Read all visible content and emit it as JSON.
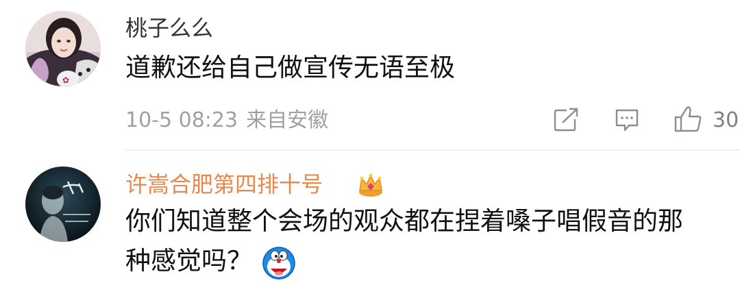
{
  "comments": [
    {
      "username": "桃子么么",
      "text": "道歉还给自己做宣传无语至极",
      "date": "10-5 08:23",
      "source": "来自安徽",
      "like_count": "30"
    },
    {
      "username": "许嵩合肥第四排十号",
      "text_line1": "你们知道整个会场的观众都在捏着嗓子唱假音的那",
      "text_line2": "种感觉吗？"
    }
  ],
  "colors": {
    "username_vip": "#e8884a",
    "username_normal": "#333333",
    "meta": "#a0a0a0"
  },
  "icons": [
    "share-icon",
    "reply-icon",
    "like-icon",
    "crown-badge-icon",
    "doraemon-emoji"
  ]
}
